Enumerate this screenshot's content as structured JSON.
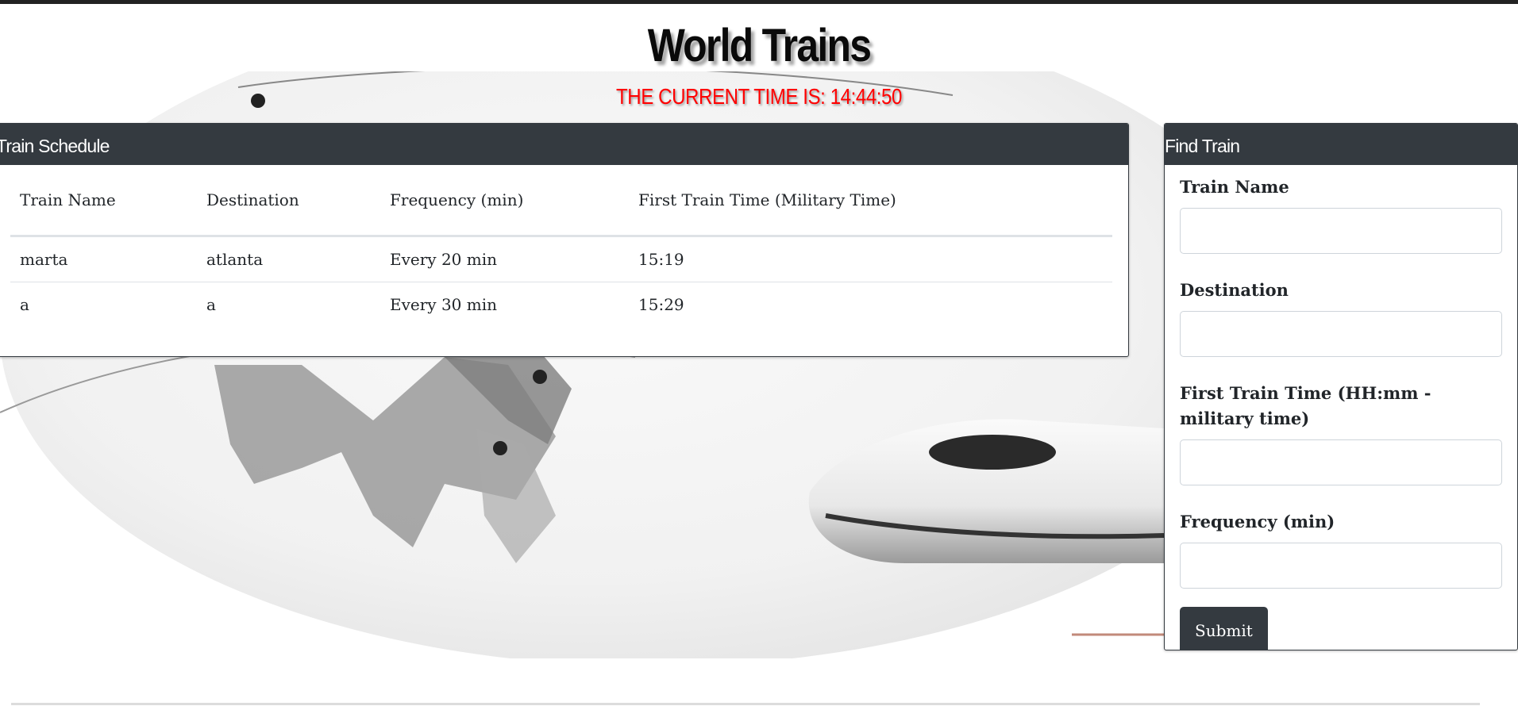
{
  "page": {
    "title": "World Trains",
    "current_time_text": "THE CURRENT TIME IS: 14:44:50"
  },
  "schedule": {
    "header": "Train Schedule",
    "columns": [
      "Train Name",
      "Destination",
      "Frequency (min)",
      "First Train Time (Military Time)"
    ],
    "rows": [
      [
        "marta",
        "atlanta",
        "Every 20 min",
        "15:19"
      ],
      [
        "a",
        "a",
        "Every 30 min",
        "15:29"
      ]
    ]
  },
  "form": {
    "header": "Find Train",
    "train_name_label": "Train Name",
    "destination_label": "Destination",
    "first_time_label": "First Train Time (HH:mm - military time)",
    "frequency_label": "Frequency (min)",
    "submit_label": "Submit"
  },
  "colors": {
    "header_bg": "#343a40",
    "time_text": "#ff0000"
  }
}
